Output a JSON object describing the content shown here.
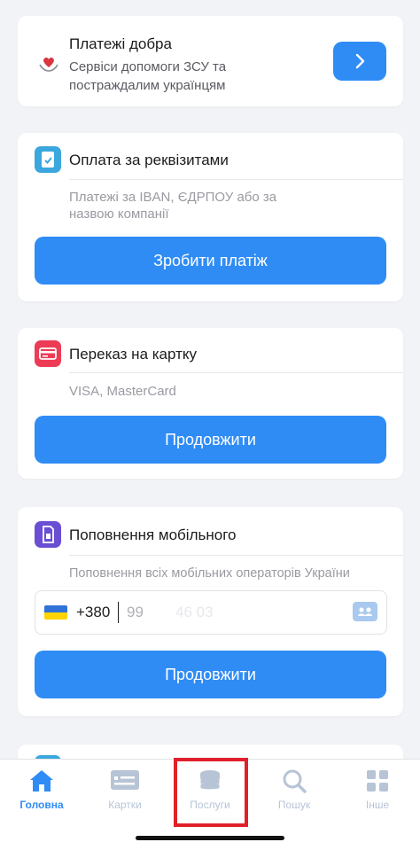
{
  "donate": {
    "title": "Платежі добра",
    "subtitle_line1": "Сервіси допомоги ЗСУ та",
    "subtitle_line2": "постраждалим українцям",
    "arrow": "›"
  },
  "requisites": {
    "title": "Оплата за реквізитами",
    "subtitle_line1": "Платежі за IBAN, ЄДРПОУ або за",
    "subtitle_line2": "назвою компанії",
    "button": "Зробити платіж"
  },
  "card_transfer": {
    "title": "Переказ на картку",
    "subtitle": "VISA, MasterCard",
    "button": "Продовжити"
  },
  "mobile": {
    "title": "Поповнення мобільного",
    "subtitle": "Поповнення всіх мобільних операторів України",
    "country_code": "+380",
    "phone_value": "99",
    "phone_blurred": "46 03",
    "button": "Продовжити"
  },
  "tabs": [
    {
      "label": "Головна",
      "icon": "home-icon",
      "active": true
    },
    {
      "label": "Картки",
      "icon": "card-icon",
      "active": false
    },
    {
      "label": "Послуги",
      "icon": "coins-icon",
      "active": false
    },
    {
      "label": "Пошук",
      "icon": "search-icon",
      "active": false
    },
    {
      "label": "Інше",
      "icon": "grid-icon",
      "active": false
    }
  ],
  "colors": {
    "accent": "#2f8cf5",
    "background": "#f2f3f7",
    "highlight_box": "#e0202a",
    "inactive_tab": "#b7c4d6"
  }
}
